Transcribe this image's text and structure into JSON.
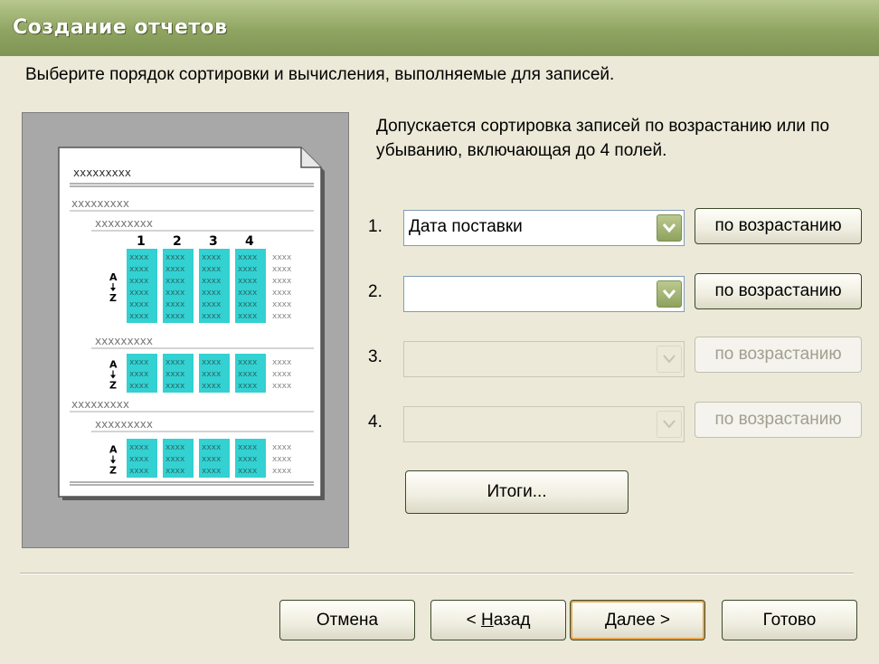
{
  "window": {
    "title": "Создание отчетов"
  },
  "instruction": "Выберите порядок сортировки и вычисления, выполняемые для записей.",
  "description": "Допускается сортировка записей по возрастанию или по убыванию, включающая до 4 полей.",
  "preview": {
    "placeholder": "xxxxxxxxx",
    "column_numbers": [
      "1",
      "2",
      "3",
      "4"
    ],
    "sort_glyph_top": "A",
    "sort_glyph_bottom": "Z",
    "accent_color": "#33d1d1"
  },
  "sort_rows": [
    {
      "number": "1.",
      "field": "Дата поставки",
      "order": "по возрастанию",
      "enabled": true
    },
    {
      "number": "2.",
      "field": "",
      "order": "по возрастанию",
      "enabled": true
    },
    {
      "number": "3.",
      "field": "",
      "order": "по возрастанию",
      "enabled": false
    },
    {
      "number": "4.",
      "field": "",
      "order": "по возрастанию",
      "enabled": false
    }
  ],
  "buttons": {
    "totals": "Итоги...",
    "cancel": "Отмена",
    "back_prefix": "< ",
    "back_key": "Н",
    "back_rest": "азад",
    "next_key": "Д",
    "next_rest": "алее >",
    "finish": "Готово"
  },
  "colors": {
    "title_bar": "#8fa461",
    "dialog_bg": "#ece9d8",
    "accent": "#33d1d1"
  }
}
